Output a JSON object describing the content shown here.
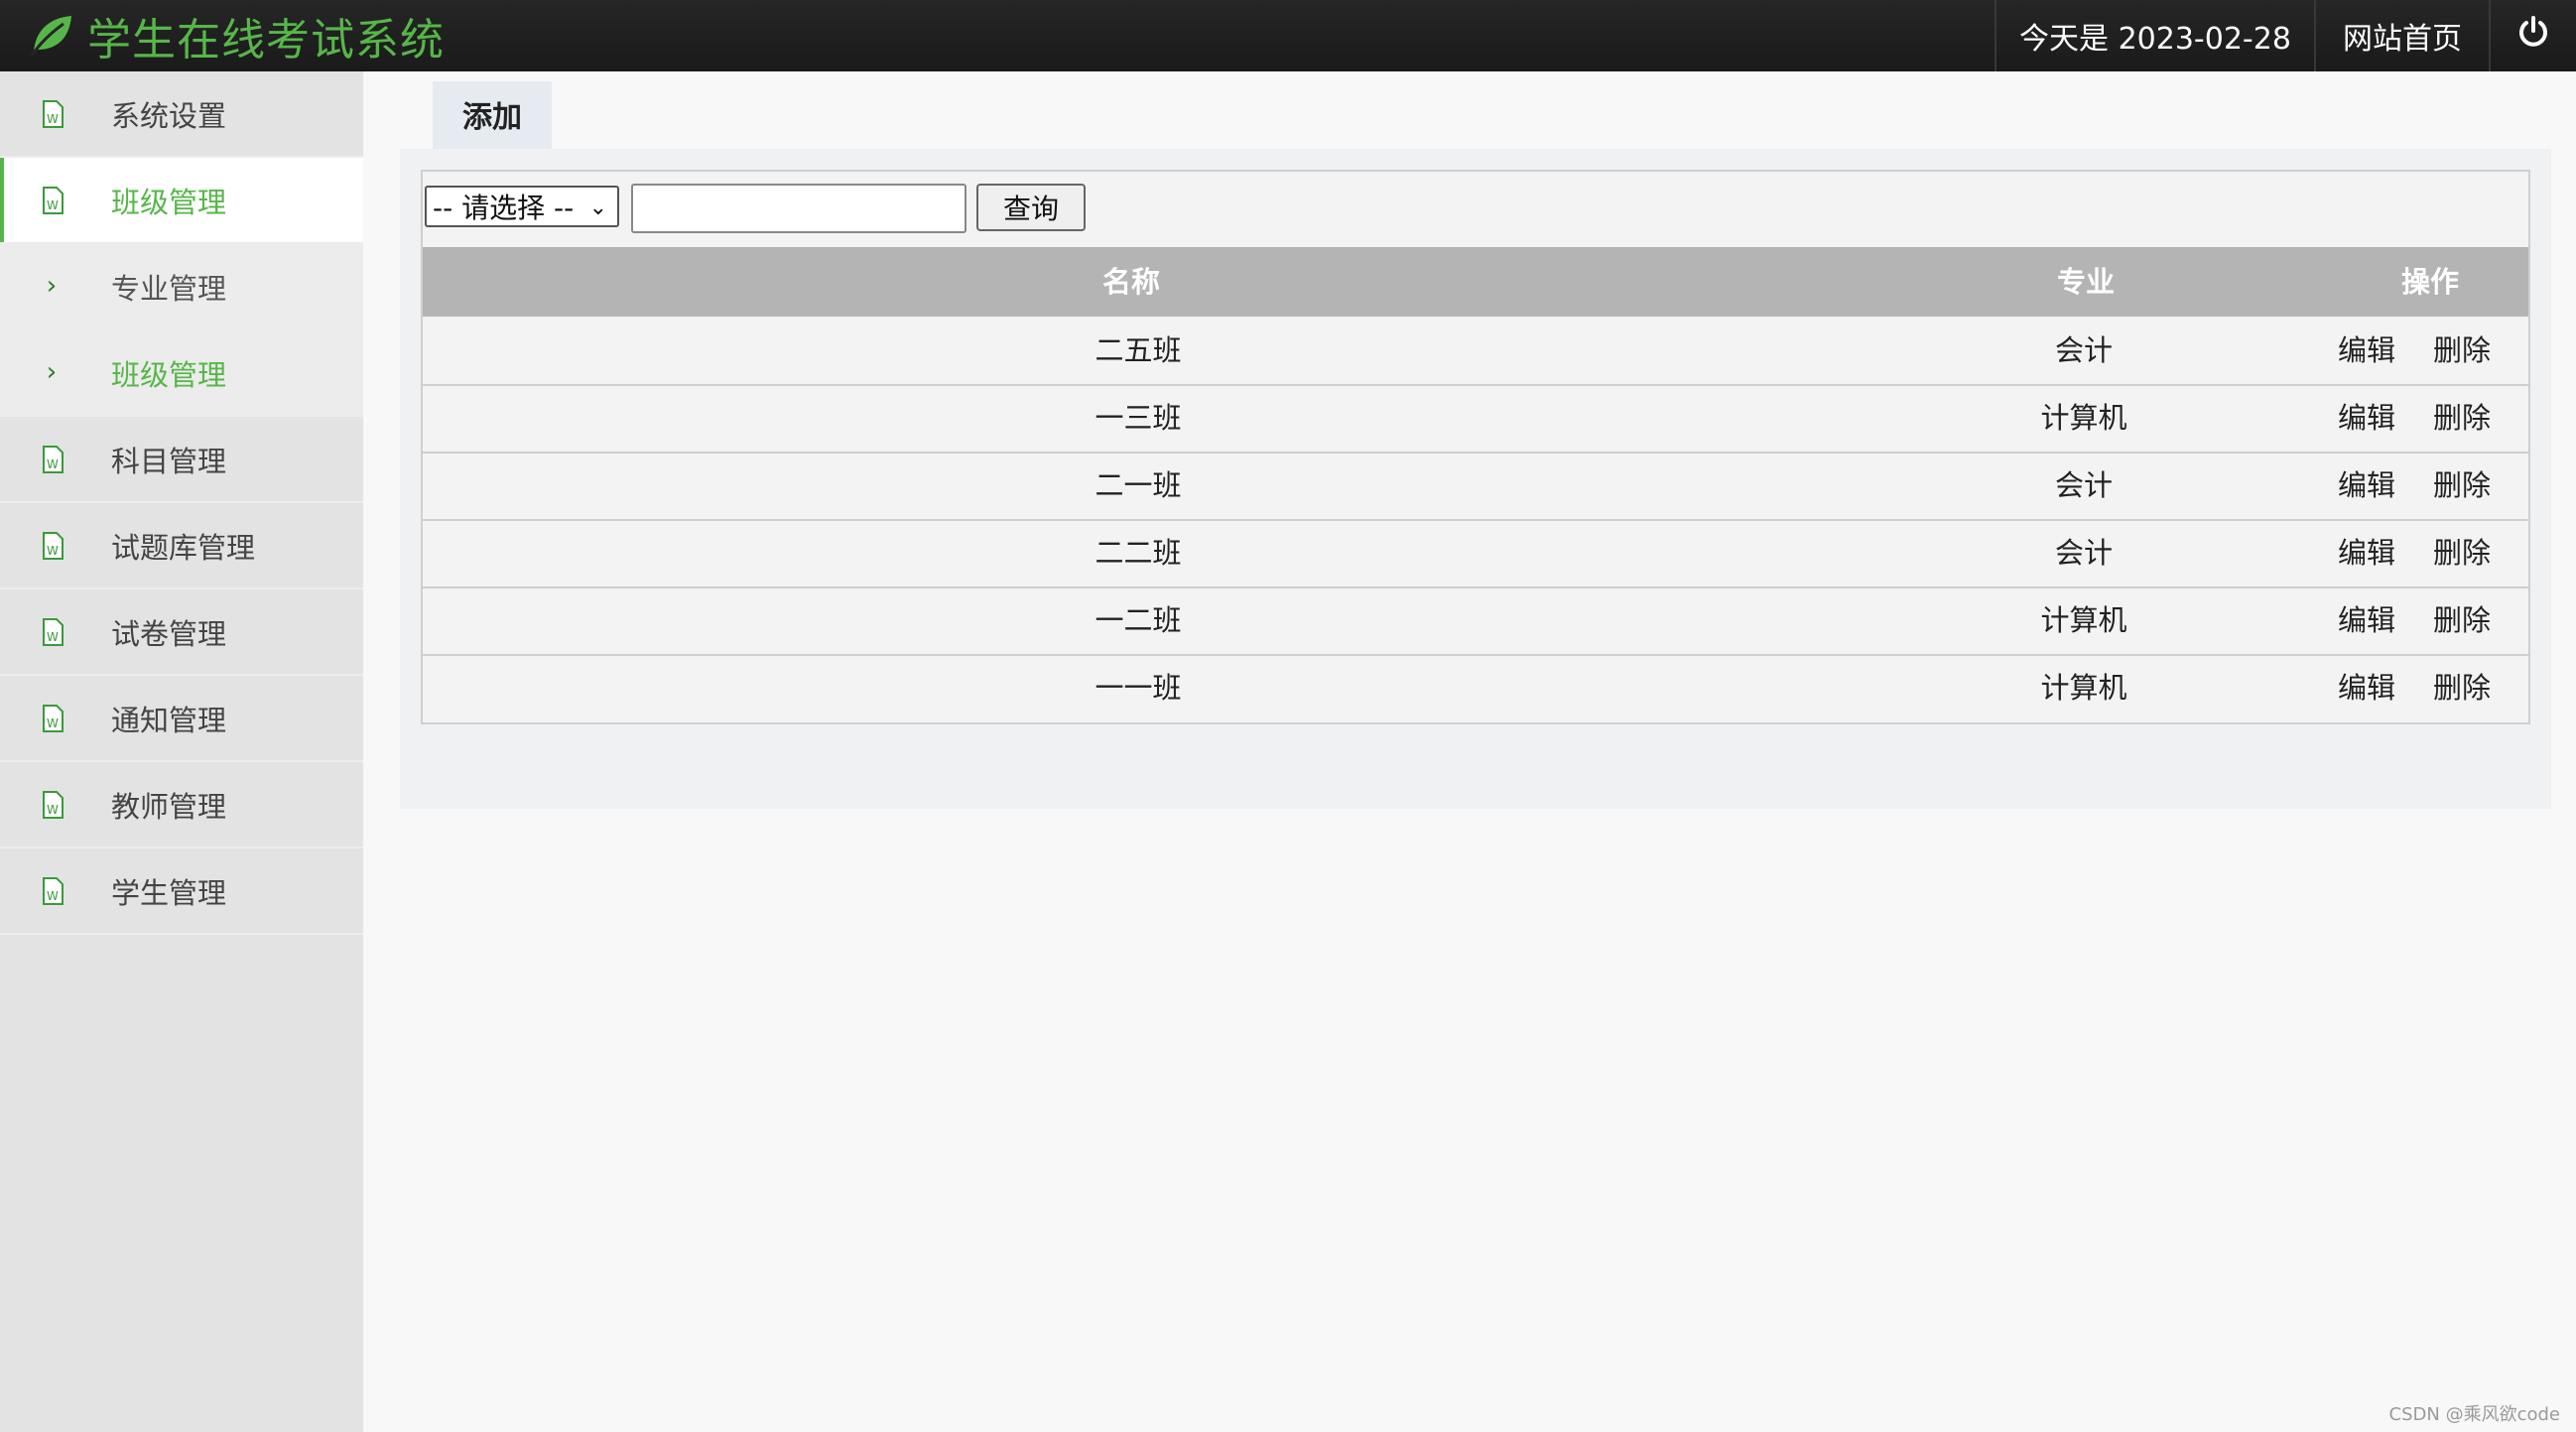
{
  "header": {
    "title": "学生在线考试系统",
    "date_text": "今天是 2023-02-28",
    "home_link": "网站首页",
    "logo_icon": "leaf-icon",
    "power_icon": "power-icon",
    "brand_color": "#57b649"
  },
  "sidebar": {
    "items": [
      {
        "label": "系统设置",
        "icon": "document-icon"
      },
      {
        "label": "班级管理",
        "icon": "document-icon",
        "active": true
      },
      {
        "label": "专业管理",
        "icon": "chevron-right-icon",
        "sub": true
      },
      {
        "label": "班级管理",
        "icon": "chevron-right-icon",
        "sub": true,
        "highlight": true
      },
      {
        "label": "科目管理",
        "icon": "document-icon"
      },
      {
        "label": "试题库管理",
        "icon": "document-icon"
      },
      {
        "label": "试卷管理",
        "icon": "document-icon"
      },
      {
        "label": "通知管理",
        "icon": "document-icon"
      },
      {
        "label": "教师管理",
        "icon": "document-icon"
      },
      {
        "label": "学生管理",
        "icon": "document-icon"
      }
    ]
  },
  "toolbar": {
    "add_label": "添加"
  },
  "search": {
    "select_value": "-- 请选择 --",
    "input_value": "",
    "query_label": "查询"
  },
  "table": {
    "headers": {
      "name": "名称",
      "major": "专业",
      "ops": "操作"
    },
    "edit_label": "编辑",
    "delete_label": "删除",
    "rows": [
      {
        "name": "二五班",
        "major": "会计"
      },
      {
        "name": "一三班",
        "major": "计算机"
      },
      {
        "name": "二一班",
        "major": "会计"
      },
      {
        "name": "二二班",
        "major": "会计"
      },
      {
        "name": "一二班",
        "major": "计算机"
      },
      {
        "name": "一一班",
        "major": "计算机"
      }
    ]
  },
  "watermark": "CSDN @乘风欲code"
}
